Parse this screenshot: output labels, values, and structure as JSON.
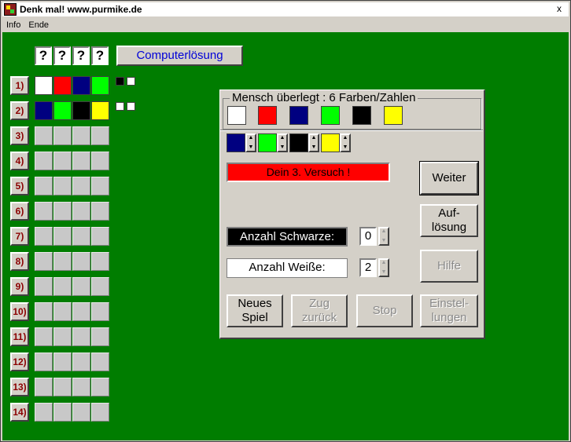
{
  "window": {
    "title": "Denk mal! www.purmike.de",
    "close": "x"
  },
  "menu": [
    "Info",
    "Ende"
  ],
  "secret": {
    "marks": [
      "?",
      "?",
      "?",
      "?"
    ],
    "button": "Computerlösung"
  },
  "colors": {
    "white": "#ffffff",
    "red": "#ff0000",
    "navy": "#000080",
    "green": "#00ff00",
    "black": "#000000",
    "yellow": "#ffff00",
    "board": "#007d00",
    "empty": "#c8c8c8"
  },
  "rows": [
    {
      "label": "1)",
      "pegs": [
        "white",
        "red",
        "navy",
        "green"
      ],
      "result": [
        "black",
        "white"
      ]
    },
    {
      "label": "2)",
      "pegs": [
        "navy",
        "green",
        "black",
        "yellow"
      ],
      "result": [
        "white",
        "white"
      ]
    },
    {
      "label": "3)",
      "pegs": [],
      "result": []
    },
    {
      "label": "4)",
      "pegs": [],
      "result": []
    },
    {
      "label": "5)",
      "pegs": [],
      "result": []
    },
    {
      "label": "6)",
      "pegs": [],
      "result": []
    },
    {
      "label": "7)",
      "pegs": [],
      "result": []
    },
    {
      "label": "8)",
      "pegs": [],
      "result": []
    },
    {
      "label": "9)",
      "pegs": [],
      "result": []
    },
    {
      "label": "10)",
      "pegs": [],
      "result": []
    },
    {
      "label": "11)",
      "pegs": [],
      "result": []
    },
    {
      "label": "12)",
      "pegs": [],
      "result": []
    },
    {
      "label": "13)",
      "pegs": [],
      "result": []
    },
    {
      "label": "14)",
      "pegs": [],
      "result": []
    }
  ],
  "panel": {
    "group_title": "Mensch überlegt : 6 Farben/Zahlen",
    "palette": [
      "white",
      "red",
      "navy",
      "green",
      "black",
      "yellow"
    ],
    "selection": [
      "navy",
      "green",
      "black",
      "yellow"
    ],
    "attempt_text": "Dein 3. Versuch !",
    "black_label": "Anzahl Schwarze:",
    "black_count": "0",
    "white_label": "Anzahl Weiße:",
    "white_count": "2",
    "buttons": {
      "next": "Weiter",
      "solve_1": "Auf-",
      "solve_2": "lösung",
      "help": "Hilfe",
      "new_1": "Neues",
      "new_2": "Spiel",
      "undo_1": "Zug",
      "undo_2": "zurück",
      "stop": "Stop",
      "settings_1": "Einstel-",
      "settings_2": "lungen"
    }
  }
}
